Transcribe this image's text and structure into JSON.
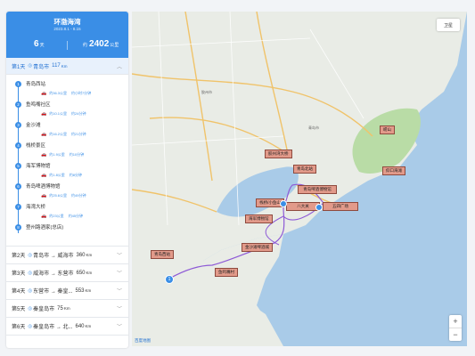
{
  "trip": {
    "title": "环渤海湾",
    "dates": "2023.8.1 - 8.15",
    "days_value": "6",
    "days_unit": "天",
    "distance_prefix": "约",
    "distance_value": "2402",
    "distance_unit": "公里"
  },
  "active_day": {
    "label": "第1天",
    "route": "青岛市",
    "km": "117",
    "km_unit": "Km"
  },
  "stops": [
    {
      "num": "1",
      "name": "青岛西站",
      "seg": "约36.3公里",
      "time": "约小时7分钟"
    },
    {
      "num": "2",
      "name": "鱼鸣嘴社区",
      "seg": "约10.1公里",
      "time": "约24分钟"
    },
    {
      "num": "3",
      "name": "金沙滩",
      "seg": "约16.2公里",
      "time": "约21分钟"
    },
    {
      "num": "4",
      "name": "栈桥景区",
      "seg": "约1.9公里",
      "time": "约10分钟"
    },
    {
      "num": "5",
      "name": "海军博物馆",
      "seg": "约1.8公里",
      "time": "约8分钟"
    },
    {
      "num": "6",
      "name": "青岛啤酒博物馆",
      "seg": "约25.6公里",
      "time": "约49分钟"
    },
    {
      "num": "7",
      "name": "海湾大桥",
      "seg": "约23公里",
      "time": "约45分钟"
    },
    {
      "num": "8",
      "name": "登州路酒家(总店)",
      "seg": "",
      "time": ""
    }
  ],
  "days": [
    {
      "label": "第2天",
      "route": "青岛市 → 威海市",
      "km": "360",
      "km_unit": "Km"
    },
    {
      "label": "第3天",
      "route": "威海市 → 东营市",
      "km": "650",
      "km_unit": "Km"
    },
    {
      "label": "第4天",
      "route": "东营市 → 秦皇...",
      "km": "553",
      "km_unit": "Km"
    },
    {
      "label": "第5天",
      "route": "秦皇岛市",
      "km": "75",
      "km_unit": "Km"
    },
    {
      "label": "第6天",
      "route": "秦皇岛市 → 北...",
      "km": "640",
      "km_unit": "Km"
    }
  ],
  "map": {
    "tool_label": "卫星",
    "zoom_in": "+",
    "zoom_out": "−",
    "logo": "百度地图",
    "labels": {
      "laoshan": "崂山",
      "yangkou": "仰口海滩",
      "bridge": "胶州湾大桥",
      "beer": "青岛啤酒博物馆",
      "north": "青岛北站",
      "zhanqiao": "栈桥/小鱼山",
      "navy": "海军博物馆",
      "wusi": "五四广场",
      "badaguan": "八大关",
      "jinsha": "金沙滩啤酒城",
      "xizhan": "青岛西站",
      "yumingzui": "鱼鸣嘴村"
    },
    "place_text": {
      "jiaozhou": "胶州市",
      "qingdao": "青岛市"
    }
  }
}
